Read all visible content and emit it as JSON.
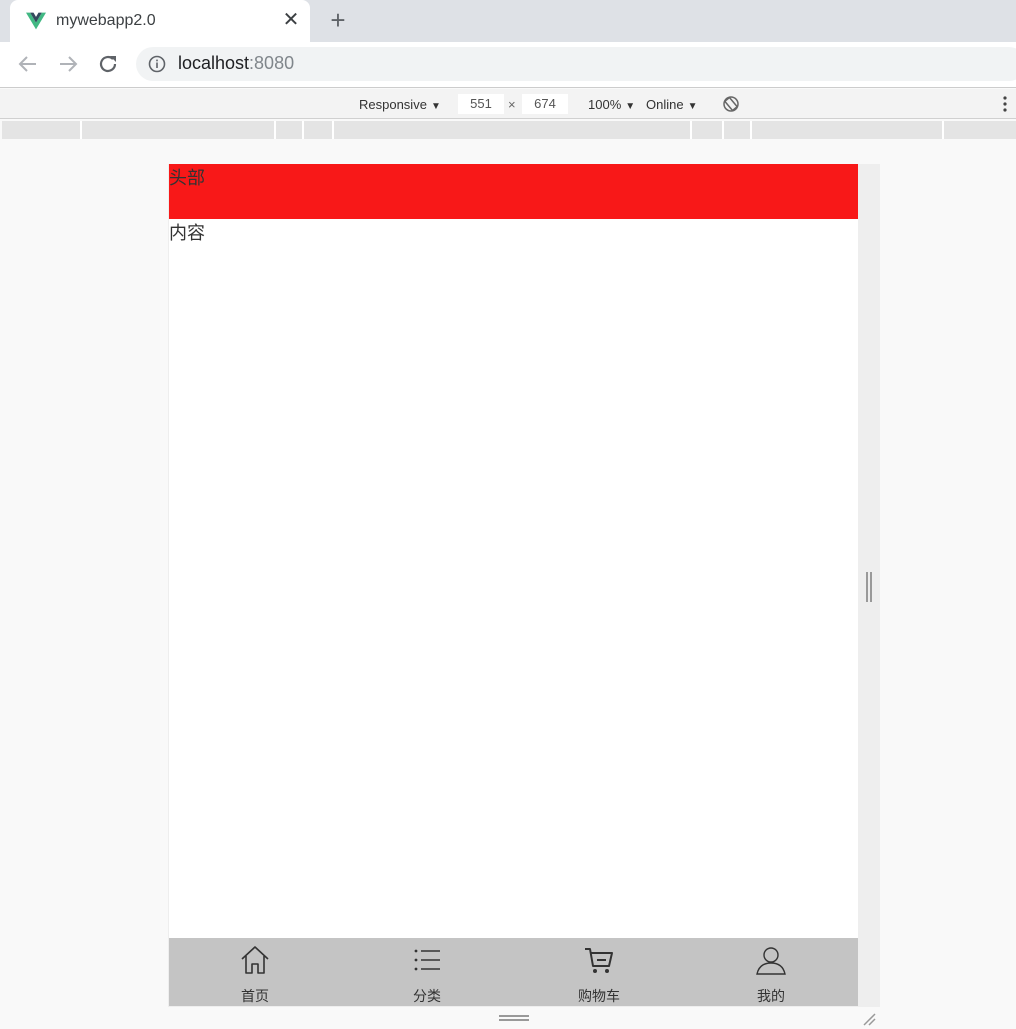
{
  "browser": {
    "tab": {
      "title": "mywebapp2.0",
      "close_label": "✕",
      "favicon": "vue-logo-icon"
    },
    "new_tab_label": "+",
    "url": {
      "host": "localhost",
      "port": ":8080"
    }
  },
  "devtools": {
    "device": "Responsive",
    "width": "551",
    "times": "×",
    "height": "674",
    "zoom": "100%",
    "network": "Online",
    "caret": "▼"
  },
  "app": {
    "header_text": "头部",
    "content_text": "内容",
    "header_color": "#f81818",
    "footer_color": "#c4c4c4",
    "nav": [
      {
        "label": "首页",
        "icon": "home-icon"
      },
      {
        "label": "分类",
        "icon": "list-icon"
      },
      {
        "label": "购物车",
        "icon": "cart-icon"
      },
      {
        "label": "我的",
        "icon": "user-icon"
      }
    ]
  }
}
